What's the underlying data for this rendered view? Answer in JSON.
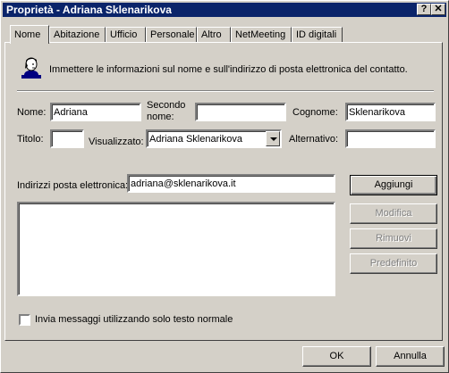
{
  "window": {
    "title": "Proprietà - Adriana Sklenarikova",
    "help_glyph": "?",
    "close_glyph": "✕"
  },
  "tabs": [
    {
      "label": "Nome",
      "active": true
    },
    {
      "label": "Abitazione"
    },
    {
      "label": "Ufficio"
    },
    {
      "label": "Personale"
    },
    {
      "label": "Altro"
    },
    {
      "label": "NetMeeting"
    },
    {
      "label": "ID digitali"
    }
  ],
  "intro": {
    "icon": "contact-card-icon",
    "text": "Immettere le informazioni sul nome e sull'indirizzo di posta elettronica del contatto."
  },
  "name_section": {
    "first_name_label": "Nome:",
    "first_name_value": "Adriana",
    "middle_name_label_1": "Secondo",
    "middle_name_label_2": "nome:",
    "middle_name_value": "",
    "last_name_label": "Cognome:",
    "last_name_value": "Sklenarikova",
    "title_label": "Titolo:",
    "title_value": "",
    "display_label": "Visualizzato:",
    "display_value": "Adriana Sklenarikova",
    "nickname_label": "Alternativo:",
    "nickname_value": ""
  },
  "email_section": {
    "label": "Indirizzi posta elettronica:",
    "input_value": "adriana@sklenarikova.it",
    "addresses": [],
    "add_button": "Aggiungi",
    "edit_button": "Modifica",
    "remove_button": "Rimuovi",
    "default_button": "Predefinito"
  },
  "plain_text_checkbox": {
    "label": "Invia messaggi utilizzando solo testo normale",
    "checked": false
  },
  "footer": {
    "ok_button": "OK",
    "cancel_button": "Annulla"
  }
}
